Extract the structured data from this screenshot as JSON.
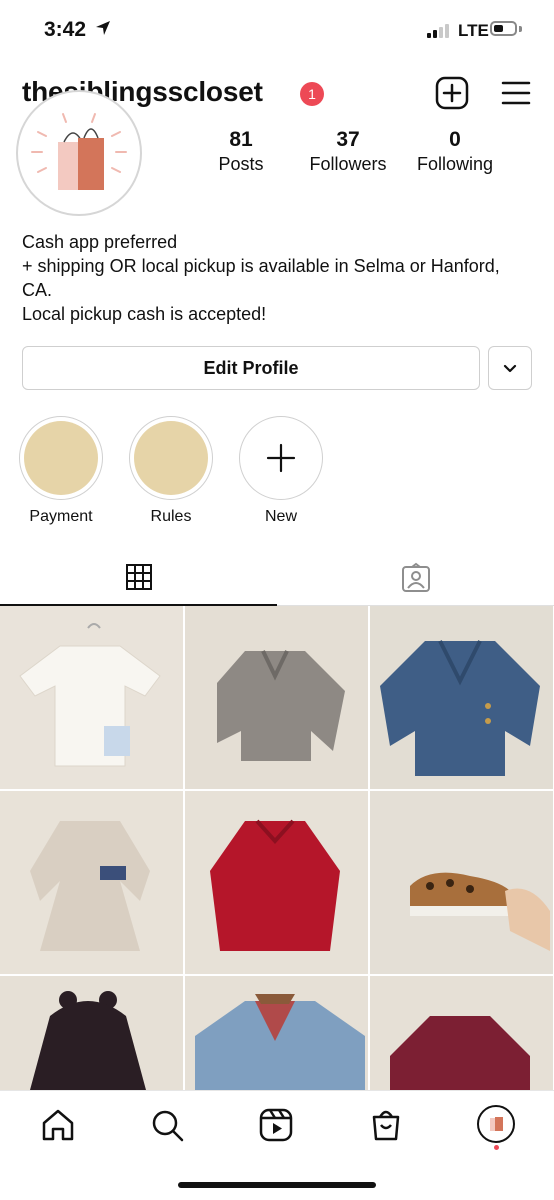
{
  "status": {
    "time": "3:42",
    "network": "LTE"
  },
  "profile": {
    "username": "thesiblingsscloset",
    "notification_count": "1",
    "stats": [
      {
        "value": "81",
        "label": "Posts"
      },
      {
        "value": "37",
        "label": "Followers"
      },
      {
        "value": "0",
        "label": "Following"
      }
    ],
    "bio": [
      "Cash app preferred",
      "+ shipping OR local pickup is available in Selma or Hanford,",
      "CA.",
      "Local pickup cash is accepted!"
    ],
    "edit_label": "Edit Profile"
  },
  "highlights": [
    {
      "label": "Payment"
    },
    {
      "label": "Rules"
    },
    {
      "label": "New"
    }
  ],
  "tabs": [
    "posts-grid",
    "tagged"
  ],
  "colors": {
    "accent": "#ed4956",
    "highlight_fill": "#e6d4a8"
  }
}
